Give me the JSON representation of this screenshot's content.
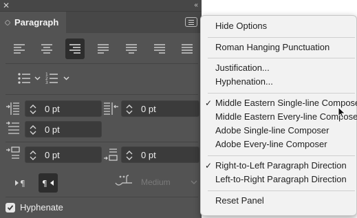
{
  "panel": {
    "tab_label": "Paragraph",
    "indents": {
      "left_indent": "0 pt",
      "right_indent": "0 pt",
      "first_line_indent": "0 pt",
      "space_before": "0 pt",
      "space_after": "0 pt"
    },
    "kashida": {
      "value": "Medium"
    },
    "hyphenate": {
      "label": "Hyphenate",
      "checked": true
    }
  },
  "menu": {
    "items": [
      {
        "label": "Hide Options",
        "checked": false
      },
      {
        "label": "Roman Hanging Punctuation",
        "checked": false
      },
      {
        "label": "Justification...",
        "checked": false
      },
      {
        "label": "Hyphenation...",
        "checked": false
      },
      {
        "label": "Middle Eastern Single-line Composer",
        "checked": true
      },
      {
        "label": "Middle Eastern Every-line Composer",
        "checked": false
      },
      {
        "label": "Adobe Single-line Composer",
        "checked": false
      },
      {
        "label": "Adobe Every-line Composer",
        "checked": false
      },
      {
        "label": "Right-to-Left Paragraph Direction",
        "checked": true
      },
      {
        "label": "Left-to-Right Paragraph Direction",
        "checked": false
      },
      {
        "label": "Reset Panel",
        "checked": false
      }
    ],
    "check_glyph": "✓"
  },
  "colors": {
    "panel_bg": "#535353",
    "field_bg": "#3b3b3b",
    "selected_btn_bg": "#2d2d2d",
    "menu_bg": "#f2f2f2"
  }
}
